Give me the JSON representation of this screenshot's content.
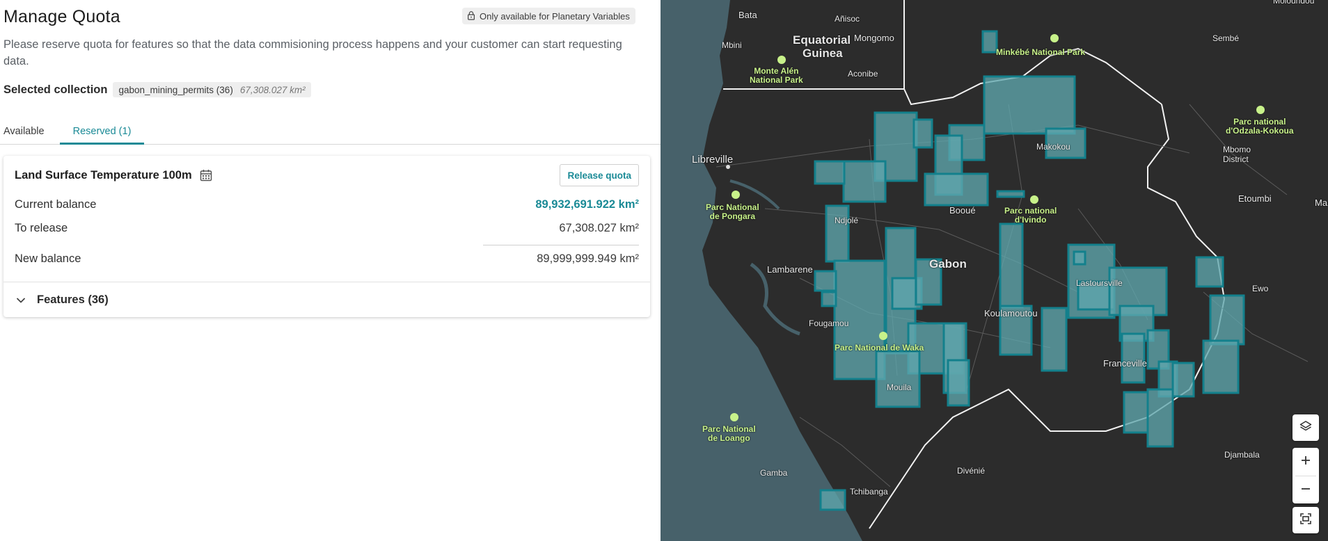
{
  "header": {
    "title": "Manage Quota",
    "availability_badge": "Only available for Planetary Variables",
    "description": "Please reserve quota for features so that the data commisioning process happens and your customer can start requesting data."
  },
  "selection": {
    "label": "Selected collection",
    "collection_name": "gabon_mining_permits (36)",
    "collection_area": "67,308.027 km²"
  },
  "tabs": [
    {
      "label": "Available",
      "active": false
    },
    {
      "label": "Reserved (1)",
      "active": true
    }
  ],
  "quota_card": {
    "title": "Land Surface Temperature 100m",
    "release_button": "Release quota",
    "rows": [
      {
        "label": "Current balance",
        "value": "89,932,691.922 km²"
      },
      {
        "label": "To release",
        "value": "67,308.027 km²"
      },
      {
        "label": "New balance",
        "value": "89,999,999.949 km²"
      }
    ],
    "features_label": "Features (36)"
  },
  "map": {
    "places": {
      "bata": "Bata",
      "anisoc": "Añisoc",
      "mbini": "Mbini",
      "eq_guinea_1": "Equatorial",
      "eq_guinea_2": "Guinea",
      "mongomo": "Mongomo",
      "aconibe": "Aconibe",
      "monte_alen": "Monte Alén\nNational Park",
      "minkebe": "Minkébé National Park",
      "sembe": "Sembé",
      "mouloundou": "Moloundou",
      "odzala": "Parc national\nd'Odzala-Kokoua",
      "mbomo": "Mbomo\nDistrict",
      "libreville": "Libreville",
      "pongara": "Parc National\nde Pongara",
      "makokou": "Makokou",
      "ivindo": "Parc national\nd'Ivindo",
      "booue": "Booué",
      "etoumbi": "Etoumbi",
      "ma": "Ma",
      "ndjole": "Ndjolé",
      "lambarene": "Lambarene",
      "gabon": "Gabon",
      "lastoursville": "Lastoursville",
      "ewo": "Ewo",
      "koulamoutou": "Koulamoutou",
      "fougamou": "Fougamou",
      "waka": "Parc National de Waka",
      "franceville": "Franceville",
      "mouila": "Mouila",
      "loango": "Parc National\nde Loango",
      "djambala": "Djambala",
      "gamba": "Gamba",
      "divenie": "Divénié",
      "tchibanga": "Tchibanga"
    },
    "polygon_color": "#5fa6ad",
    "polygon_stroke": "#13808c",
    "map_bg": "#2c2c2c",
    "water_color": "#47616a",
    "controls": [
      "layers-icon",
      "zoom-in-icon",
      "zoom-out-icon",
      "fit-bounds-icon"
    ]
  },
  "colors": {
    "accent": "#1a8a96",
    "text": "#1f2328",
    "muted": "#5b6066"
  }
}
